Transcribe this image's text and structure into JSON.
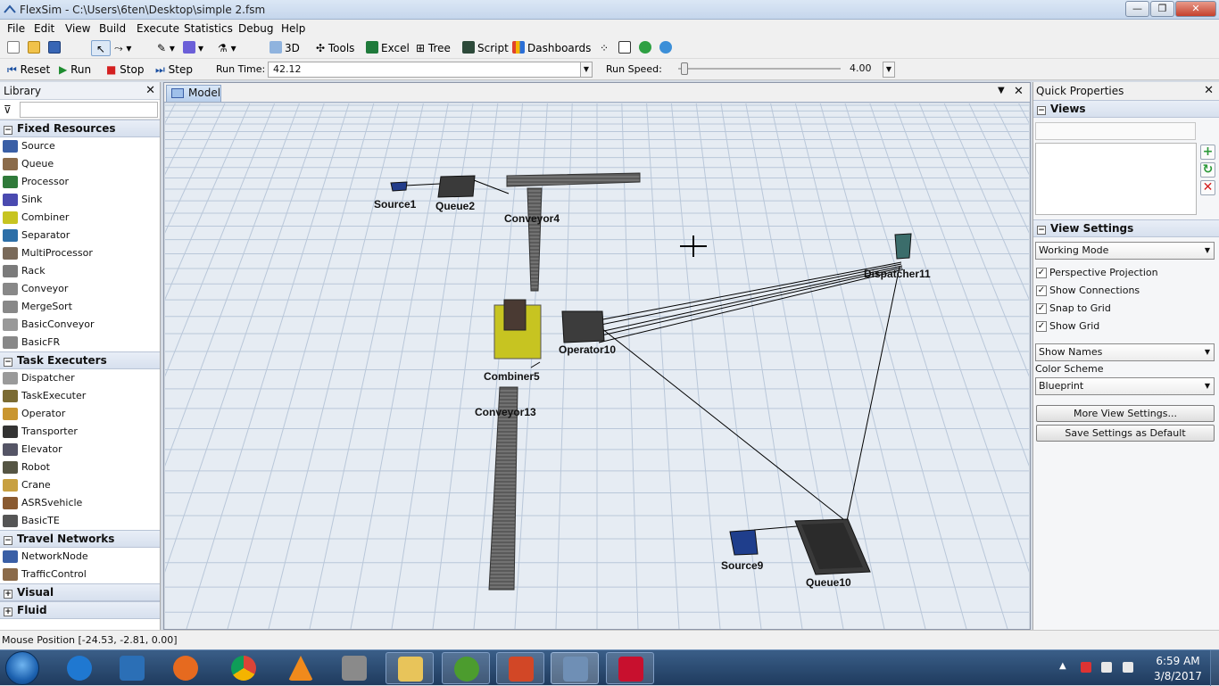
{
  "window": {
    "title": "FlexSim - C:\\Users\\6ten\\Desktop\\simple 2.fsm",
    "min_glyph": "—",
    "max_glyph": "❐",
    "close_glyph": "✕"
  },
  "menu": [
    "File",
    "Edit",
    "View",
    "Build",
    "Execute",
    "Statistics",
    "Debug",
    "Help"
  ],
  "toolbar": {
    "view_3d": "3D",
    "tools": "Tools",
    "excel": "Excel",
    "tree": "Tree",
    "script": "Script",
    "dashboards": "Dashboards"
  },
  "runbar": {
    "reset": "Reset",
    "run": "Run",
    "stop": "Stop",
    "step": "Step",
    "run_time_label": "Run Time:",
    "run_time_value": "42.12",
    "run_speed_label": "Run Speed:",
    "run_speed_value": "4.00",
    "run_speed_fraction": 0.02
  },
  "library": {
    "title": "Library",
    "categories": [
      {
        "name": "Fixed Resources",
        "expanded": true,
        "items": [
          "Source",
          "Queue",
          "Processor",
          "Sink",
          "Combiner",
          "Separator",
          "MultiProcessor",
          "Rack",
          "Conveyor",
          "MergeSort",
          "BasicConveyor",
          "BasicFR"
        ]
      },
      {
        "name": "Task Executers",
        "expanded": true,
        "items": [
          "Dispatcher",
          "TaskExecuter",
          "Operator",
          "Transporter",
          "Elevator",
          "Robot",
          "Crane",
          "ASRSvehicle",
          "BasicTE"
        ]
      },
      {
        "name": "Travel Networks",
        "expanded": true,
        "items": [
          "NetworkNode",
          "TrafficControl"
        ]
      },
      {
        "name": "Visual",
        "expanded": false,
        "items": []
      },
      {
        "name": "Fluid",
        "expanded": false,
        "items": []
      }
    ]
  },
  "viewport": {
    "tab": "Model",
    "objects": {
      "source1": "Source1",
      "queue2": "Queue2",
      "conveyor4": "Conveyor4",
      "dispatcher11": "Dispatcher11",
      "operator10": "Operator10",
      "combiner5": "Combiner5",
      "conveyor13": "Conveyor13",
      "source9": "Source9",
      "queue10": "Queue10"
    }
  },
  "quick_properties": {
    "title": "Quick Properties",
    "views_section": "Views",
    "view_settings_section": "View Settings",
    "working_mode": "Working Mode",
    "checkboxes": [
      {
        "label": "Perspective Projection",
        "checked": true
      },
      {
        "label": "Show Connections",
        "checked": true
      },
      {
        "label": "Snap to Grid",
        "checked": true
      },
      {
        "label": "Show Grid",
        "checked": true
      }
    ],
    "show_names": "Show Names",
    "color_scheme_label": "Color Scheme",
    "color_scheme": "Blueprint",
    "more_settings_button": "More View Settings...",
    "save_default_button": "Save Settings as Default"
  },
  "status": {
    "mouse_position": "Mouse Position [-24.53, -2.81, 0.00]"
  },
  "taskbar": {
    "time": "6:59 AM",
    "date": "3/8/2017"
  },
  "colors": {
    "grid_bg": "#e6ecf3",
    "grid_line": "#b9c7d9",
    "accent": "#3b5fa6"
  }
}
